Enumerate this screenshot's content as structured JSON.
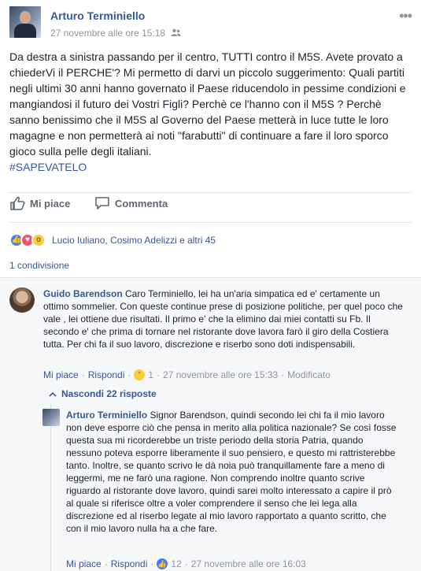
{
  "post": {
    "author": "Arturo Terminiello",
    "timestamp": "27 novembre alle ore 15:18",
    "text": "Da destra a sinistra passando per il centro, TUTTI contro il M5S. Avete provato a chiederVi il PERCHE'? Mi permetto di darvi un piccolo suggerimento: Quali partiti negli ultimi 30 anni hanno governato il Paese riducendolo in pessime condizioni e mangiandosi il futuro dei Vostri Figli? Perchè ce l'hanno con il M5S ? Perchè sanno benissimo che il M5S al Governo del Paese metterà in luce tutte le loro magagne e non permetterà ai noti \"farabutti\" di continuare a fare il loro sporco gioco sulla pelle degli italiani.",
    "hashtag": "#SAPEVATELO"
  },
  "actions": {
    "like_label": "Mi piace",
    "comment_label": "Commenta"
  },
  "reactions": {
    "summary": "Lucio Iuliano, Cosimo Adelizzi e altri 45"
  },
  "shares": "1 condivisione",
  "comments": [
    {
      "author": "Guido Barendson",
      "text": "Caro Terminiello, lei ha un'aria simpatica ed e' certamente un ottimo sommelier. Con queste continue prese di posizione politiche, per quel poco che vale , lei ottiene due risultati. Il primo e' che la elimino dai miei contatti su Fb. Il secondo e' che prima di tornare nel ristorante dove lavora farò il giro della Costiera tutta. Per chi fa il suo lavoro, discrezione e riserbo sono doti indispensabili.",
      "like_label": "Mi piace",
      "reply_label": "Rispondi",
      "reaction_count": "1",
      "timestamp": "27 novembre alle ore 15:33",
      "edited": "Modificato"
    }
  ],
  "hide_replies": "Nascondi 22 risposte",
  "reply": {
    "author": "Arturo Terminiello",
    "text": "Signor Barendson, quindi secondo lei chi fa il mio lavoro non deve esporre ciò che pensa in merito alla politica nazionale? Se così fosse questa sua mi ricorderebbe un triste periodo della storia Patria, quando nessuno poteva esporre liberamente il suo pensiero, e questo mi rattristerebbe tanto. Inoltre, se quanto scrivo le dà noia può tranquillamente fare a meno di leggermi, me ne farò una ragione. Non comprendo inoltre quanto scrive riguardo al ristorante dove lavoro, quindi sarei molto interessato a capire il prò al quale si riferisce oltre a voler comprendere il senso che lei lega alla discrezione ed al riserbo legate al mio lavoro rapportato a quanto scritto, che con il mio lavoro nulla ha a che fare.",
    "like_label": "Mi piace",
    "reply_label": "Rispondi",
    "reaction_count": "12",
    "timestamp": "27 novembre alle ore 16:03"
  },
  "colors": {
    "link": "#365899",
    "muted": "#90949c",
    "like_blue": "#4080ff",
    "love_red": "#f25268",
    "wow_yellow": "#fcca3d"
  }
}
